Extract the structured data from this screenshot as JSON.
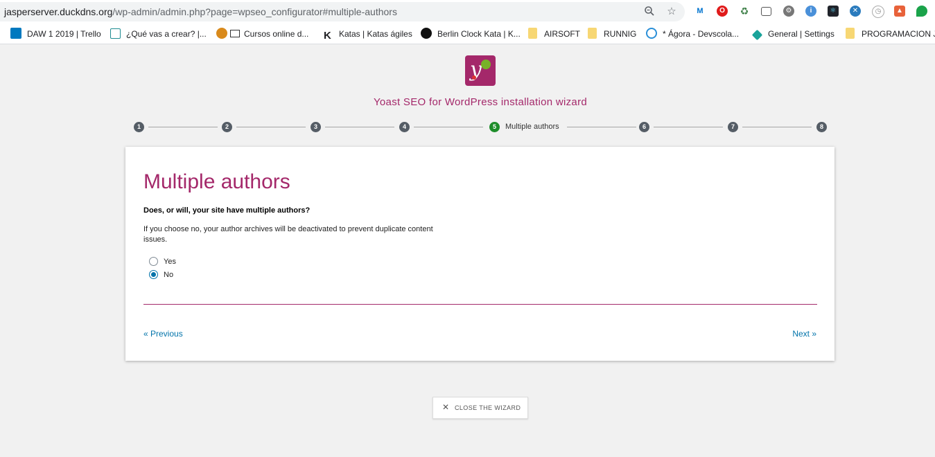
{
  "browser": {
    "url_host": "jasperserver.duckdns.org",
    "url_path": "/wp-admin/admin.php?page=wpseo_configurator#multiple-authors",
    "zoom_icon": "zoom-icon",
    "star_icon": "star-icon",
    "bookmarks": [
      {
        "label": "DAW 1 2019 | Trello",
        "icon": "trello-icon",
        "color": "#0079bf"
      },
      {
        "label": "¿Qué vas a crear? |...",
        "icon": "grid-icon",
        "color": "#1e8c92"
      },
      {
        "label": "Cursos online d...",
        "icon": "courses-icon",
        "color": "#d98a1c"
      },
      {
        "label": "Katas | Katas ágiles",
        "icon": "k-icon",
        "color": "#111111"
      },
      {
        "label": "Berlin Clock Kata | K...",
        "icon": "clock-icon",
        "color": "#111111"
      },
      {
        "label": "AIRSOFT",
        "icon": "folder-icon",
        "color": "#f7d774"
      },
      {
        "label": "RUNNIG",
        "icon": "folder-icon",
        "color": "#f7d774"
      },
      {
        "label": "* Ágora - Devscola...",
        "icon": "agora-icon",
        "color": "#2a8fd8"
      },
      {
        "label": "General | Settings",
        "icon": "diamond-icon",
        "color": "#1aa39a"
      },
      {
        "label": "PROGRAMACION J...",
        "icon": "folder-icon",
        "color": "#f7d774"
      }
    ]
  },
  "wizard": {
    "title": "Yoast SEO for WordPress installation wizard",
    "steps": [
      "1",
      "2",
      "3",
      "4",
      "5",
      "6",
      "7",
      "8"
    ],
    "active_step": 5,
    "active_label": "Multiple authors",
    "heading": "Multiple authors",
    "question": "Does, or will, your site have multiple authors?",
    "description": "If you choose no, your author archives will be deactivated to prevent duplicate content issues.",
    "options": [
      {
        "label": "Yes",
        "checked": false
      },
      {
        "label": "No",
        "checked": true
      }
    ],
    "previous_label": "« Previous",
    "next_label": "Next »",
    "close_label": "CLOSE THE WIZARD",
    "accent_color": "#a4286a",
    "link_color": "#0073aa",
    "active_step_color": "#1e8d2a"
  }
}
